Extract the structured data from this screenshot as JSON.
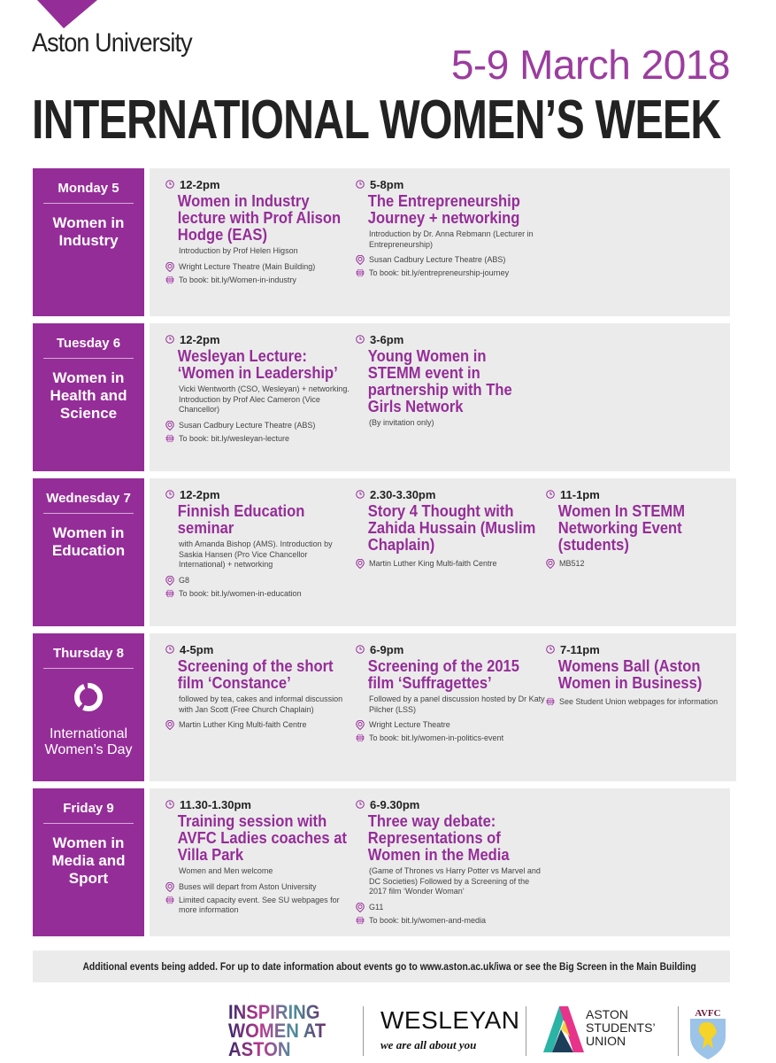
{
  "header": {
    "brand": "Aston University",
    "date_range": "5-9 March 2018",
    "title": "INTERNATIONAL WOMEN’S WEEK"
  },
  "colors": {
    "accent_purple": "#952d98",
    "date_purple": "#9b3d9e",
    "panel_grey": "#ebebeb",
    "text_dark": "#222222"
  },
  "icons": {
    "time": "clock-icon",
    "location": "map-pin-icon",
    "booking": "globe-icon"
  },
  "days": [
    {
      "name": "Monday 5",
      "theme": "Women in Industry",
      "events": [
        {
          "time": "12-2pm",
          "title": "Women in Industry lecture with Prof Alison Hodge (EAS)",
          "description": "Introduction by Prof Helen Higson",
          "location": "Wright Lecture Theatre (Main Building)",
          "booking": "To book: bit.ly/Women-in-industry"
        },
        {
          "time": "5-8pm",
          "title": "The Entrepreneurship Journey + networking",
          "description": "Introduction by Dr. Anna Rebmann (Lecturer in Entrepreneurship)",
          "location": "Susan Cadbury Lecture Theatre (ABS)",
          "booking": "To book: bit.ly/entrepreneurship-journey"
        }
      ]
    },
    {
      "name": "Tuesday 6",
      "theme": "Women in Health and Science",
      "events": [
        {
          "time": "12-2pm",
          "title": "Wesleyan Lecture: ‘Women in Leadership’",
          "description": "Vicki Wentworth (CSO, Wesleyan) + networking. Introduction by Prof Alec Cameron (Vice Chancellor)",
          "location": "Susan Cadbury Lecture Theatre (ABS)",
          "booking": "To book: bit.ly/wesleyan-lecture"
        },
        {
          "time": "3-6pm",
          "title": "Young Women in STEMM event in partnership with The Girls Network",
          "description": "(By invitation only)"
        }
      ]
    },
    {
      "name": "Wednesday 7",
      "theme": "Women in Education",
      "events": [
        {
          "time": "12-2pm",
          "title": "Finnish Education seminar",
          "description": "with Amanda Bishop (AMS). Introduction by Saskia Hansen (Pro Vice Chancellor International) + networking",
          "location": "G8",
          "booking": "To book: bit.ly/women-in-education"
        },
        {
          "time": "2.30-3.30pm",
          "title": "Story 4 Thought with Zahida Hussain (Muslim Chaplain)",
          "location": "Martin Luther King Multi-faith Centre"
        },
        {
          "time": "11-1pm",
          "title": "Women In STEMM Networking Event (students)",
          "location": "MB512"
        }
      ]
    },
    {
      "name": "Thursday 8",
      "theme": "International Women’s Day",
      "theme_icon": "iwd-circle-arrows-icon",
      "events": [
        {
          "time": "4-5pm",
          "title": "Screening of the short film ‘Constance’",
          "description": "followed by tea, cakes and informal discussion with Jan Scott (Free Church Chaplain)",
          "location": "Martin Luther King Multi-faith Centre"
        },
        {
          "time": "6-9pm",
          "title": "Screening of the 2015 film ‘Suffragettes’",
          "description": "Followed by a panel discussion hosted by Dr Katy Pilcher (LSS)",
          "location": "Wright Lecture Theatre",
          "booking": "To book: bit.ly/women-in-politics-event"
        },
        {
          "time": "7-11pm",
          "title": "Womens Ball (Aston Women in Business)",
          "booking": "See Student Union webpages for information"
        }
      ]
    },
    {
      "name": "Friday 9",
      "theme": "Women in Media and Sport",
      "events": [
        {
          "time": "11.30-1.30pm",
          "title": "Training session with AVFC Ladies coaches at Villa Park",
          "description": "Women and Men welcome",
          "location": "Buses will depart from Aston University",
          "booking": "Limited capacity event. See SU webpages for more information"
        },
        {
          "time": "6-9.30pm",
          "title": "Three way debate: Representations of Women in the Media",
          "description": "(Game of Thrones vs Harry Potter vs Marvel and DC Societies) Followed by a Screening of the 2017 film ‘Wonder Woman’",
          "location": "G11",
          "booking": "To book: bit.ly/women-and-media"
        }
      ]
    }
  ],
  "footer": {
    "note": "Additional events being added. For up to date information about events go to www.aston.ac.uk/iwa or see the Big Screen in the Main Building"
  },
  "sponsors": {
    "iwa": "INSPIRING WOMEN AT ASTON",
    "iwa_lines": [
      "INSPIRING",
      "WOMEN AT",
      "ASTON"
    ],
    "wesleyan": "WESLEYAN",
    "wesleyan_tagline": "we are all about you",
    "su_lines": [
      "ASTON",
      "STUDENTS’",
      "UNION"
    ],
    "avfc": "AVFC"
  }
}
